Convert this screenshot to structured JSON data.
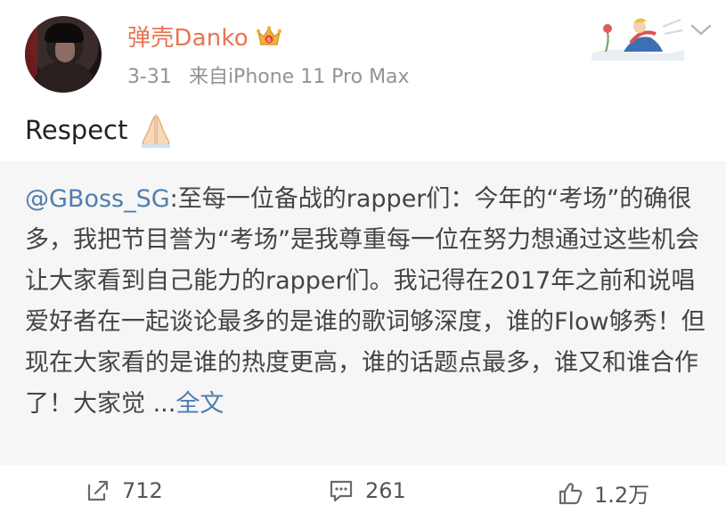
{
  "post": {
    "author": "弹壳Danko",
    "date": "3-31",
    "source": "来自iPhone 11 Pro Max",
    "text": "Respect",
    "emoji_icon": "folded-hands-icon",
    "badge_icon": "crown-badge-icon"
  },
  "repost": {
    "mention": "@GBoss_SG",
    "body": ":至每一位备战的rapper们：今年的“考场”的确很多，我把节目誉为“考场”是我尊重每一位在努力想通过这些机会让大家看到自己能力的rapper们。我记得在2017年之前和说唱爱好者在一起谈论最多的是谁的歌词够深度，谁的Flow够秀！但现在大家看的是谁的热度更高，谁的话题点最多，谁又和谁合作了！大家觉 ...",
    "more_label": "全文"
  },
  "actions": {
    "repost_count": "712",
    "comment_count": "261",
    "like_count": "1.2万"
  },
  "colors": {
    "username": "#eb7350",
    "link": "#507daf",
    "meta": "#939393",
    "repost_bg": "#f6f6f6"
  }
}
